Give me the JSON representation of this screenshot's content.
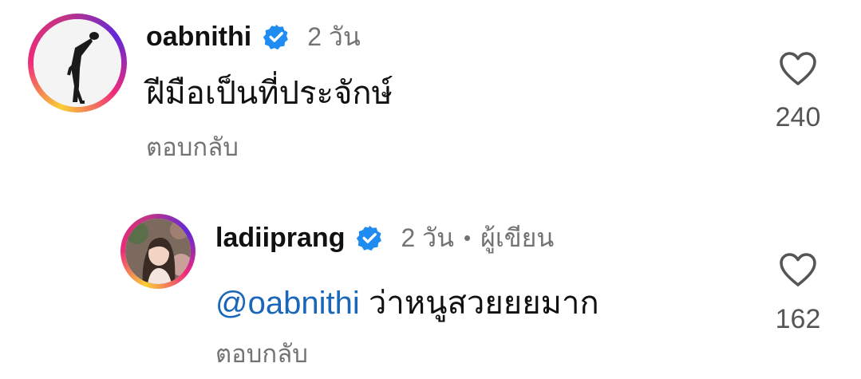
{
  "comments": [
    {
      "username": "oabnithi",
      "time": "2 วัน",
      "text": "ฝีมือเป็นที่ประจักษ์",
      "reply_label": "ตอบกลับ",
      "likes": "240"
    },
    {
      "username": "ladiiprang",
      "time": "2 วัน",
      "separator": "•",
      "author_label": "ผู้เขียน",
      "mention": "@oabnithi",
      "text": "ว่าหนูสวยยยมาก",
      "reply_label": "ตอบกลับ",
      "likes": "162"
    }
  ],
  "colors": {
    "verified": "#1f8cf2",
    "mention": "#1a66b8",
    "muted": "#737373"
  },
  "icons": {
    "verified": "verified-badge-icon",
    "like": "heart-outline-icon"
  }
}
